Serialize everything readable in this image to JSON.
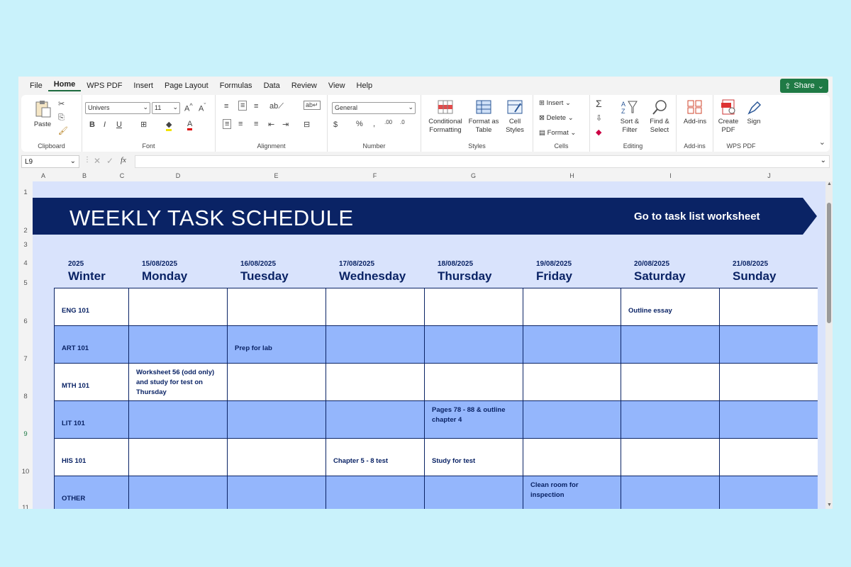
{
  "menu": {
    "tabs": [
      "File",
      "Home",
      "WPS PDF",
      "Insert",
      "Page Layout",
      "Formulas",
      "Data",
      "Review",
      "View",
      "Help"
    ],
    "active": "Home",
    "share": "Share"
  },
  "ribbon": {
    "clipboard": {
      "label": "Clipboard",
      "paste": "Paste"
    },
    "font": {
      "label": "Font",
      "family": "Univers",
      "size": "11"
    },
    "alignment": {
      "label": "Alignment"
    },
    "number": {
      "label": "Number",
      "format": "General"
    },
    "styles": {
      "label": "Styles",
      "conditional": "Conditional Formatting",
      "format_table": "Format as Table",
      "cell_styles": "Cell Styles"
    },
    "cells": {
      "label": "Cells",
      "insert": "Insert",
      "delete": "Delete",
      "format": "Format"
    },
    "editing": {
      "label": "Editing",
      "sort": "Sort & Filter",
      "find": "Find & Select"
    },
    "addins": {
      "label": "Add-ins",
      "btn": "Add-ins"
    },
    "wpspdf": {
      "label": "WPS PDF",
      "create": "Create PDF",
      "sign": "Sign"
    }
  },
  "formula_bar": {
    "name_box": "L9",
    "fx": "fx",
    "value": ""
  },
  "columns": [
    "A",
    "B",
    "C",
    "D",
    "E",
    "F",
    "G",
    "H",
    "I",
    "J"
  ],
  "rows": [
    "1",
    "2",
    "3",
    "4",
    "5",
    "6",
    "7",
    "8",
    "9",
    "10",
    "11"
  ],
  "sheet": {
    "title": "WEEKLY TASK SCHEDULE",
    "link": "Go to task list worksheet",
    "year": "2025",
    "season": "Winter",
    "days": [
      {
        "date": "15/08/2025",
        "name": "Monday"
      },
      {
        "date": "16/08/2025",
        "name": "Tuesday"
      },
      {
        "date": "17/08/2025",
        "name": "Wednesday"
      },
      {
        "date": "18/08/2025",
        "name": "Thursday"
      },
      {
        "date": "19/08/2025",
        "name": "Friday"
      },
      {
        "date": "20/08/2025",
        "name": "Saturday"
      },
      {
        "date": "21/08/2025",
        "name": "Sunday"
      }
    ],
    "tasks": [
      {
        "course": "ENG 101",
        "cells": [
          "",
          "",
          "",
          "",
          "",
          "Outline essay",
          ""
        ]
      },
      {
        "course": "ART 101",
        "cells": [
          "",
          "Prep for lab",
          "",
          "",
          "",
          "",
          ""
        ]
      },
      {
        "course": "MTH 101",
        "cells": [
          "Worksheet 56 (odd only) and study for test on Thursday",
          "",
          "",
          "",
          "",
          "",
          ""
        ]
      },
      {
        "course": "LIT 101",
        "cells": [
          "",
          "",
          "",
          "Pages 78 - 88 & outline chapter 4",
          "",
          "",
          ""
        ]
      },
      {
        "course": "HIS 101",
        "cells": [
          "",
          "",
          "Chapter 5 - 8 test",
          "Study for test",
          "",
          "",
          ""
        ]
      },
      {
        "course": "OTHER",
        "cells": [
          "",
          "",
          "",
          "",
          "Clean room for inspection",
          "",
          ""
        ]
      }
    ]
  },
  "colors": {
    "navy": "#0a2365",
    "band": "#94b6fc",
    "bg": "#d9e3fc",
    "accent": "#1f7a45"
  }
}
